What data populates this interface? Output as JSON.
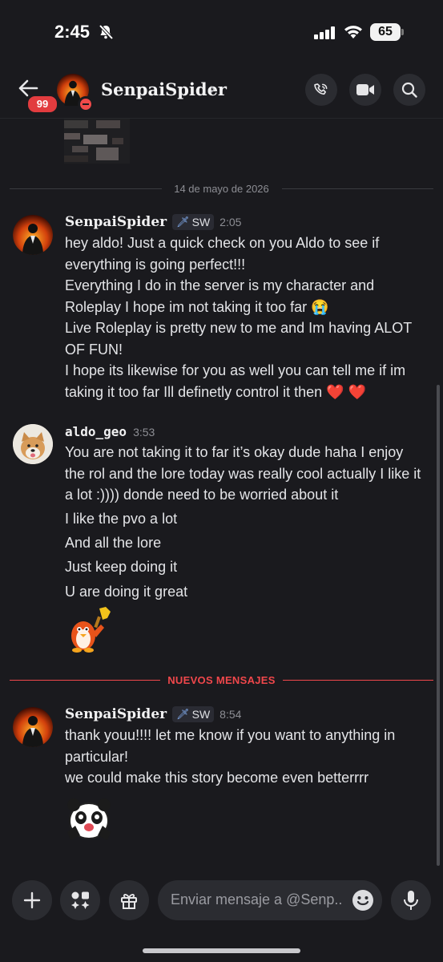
{
  "status_bar": {
    "time": "2:45",
    "battery": "65"
  },
  "header": {
    "name": "SenpaiSpider",
    "chevron": "›",
    "badge": "99"
  },
  "date_separator": "14 de mayo de 2026",
  "messages": [
    {
      "author": "SenpaiSpider",
      "tag": "SW",
      "time": "2:05",
      "lines": [
        "hey aldo! Just a quick check on you Aldo to see if everything is going perfect!!!",
        "Everything I do in the server is my character and Roleplay I hope im not taking it too far 😭",
        "Live Roleplay is pretty new to me and Im having ALOT OF FUN!",
        "I hope its likewise for you as well you can tell me if im taking it too far Ill definetly control it then ❤️ ❤️"
      ]
    },
    {
      "author": "aldo_geo",
      "time": "3:53",
      "lines": [
        "You are not taking it to far it’s okay dude haha I enjoy the rol and the lore today was really cool actually I like it a lot :)))) donde need to be worried about it",
        "I like the pvo a lot",
        "And all the lore",
        "Just keep doing it",
        "U are doing it great"
      ]
    },
    {
      "author": "SenpaiSpider",
      "tag": "SW",
      "time": "8:54",
      "lines": [
        "thank youu!!!! let me know if you want to anything in particular!",
        "we could make this story become even betterrrr"
      ]
    }
  ],
  "new_messages_label": "NUEVOS MENSAJES",
  "composer": {
    "placeholder": "Enviar mensaje a @Senp.."
  },
  "colors": {
    "background": "#1a1a1e",
    "accent_red": "#f0474b",
    "badge_red": "#e23c3f"
  }
}
